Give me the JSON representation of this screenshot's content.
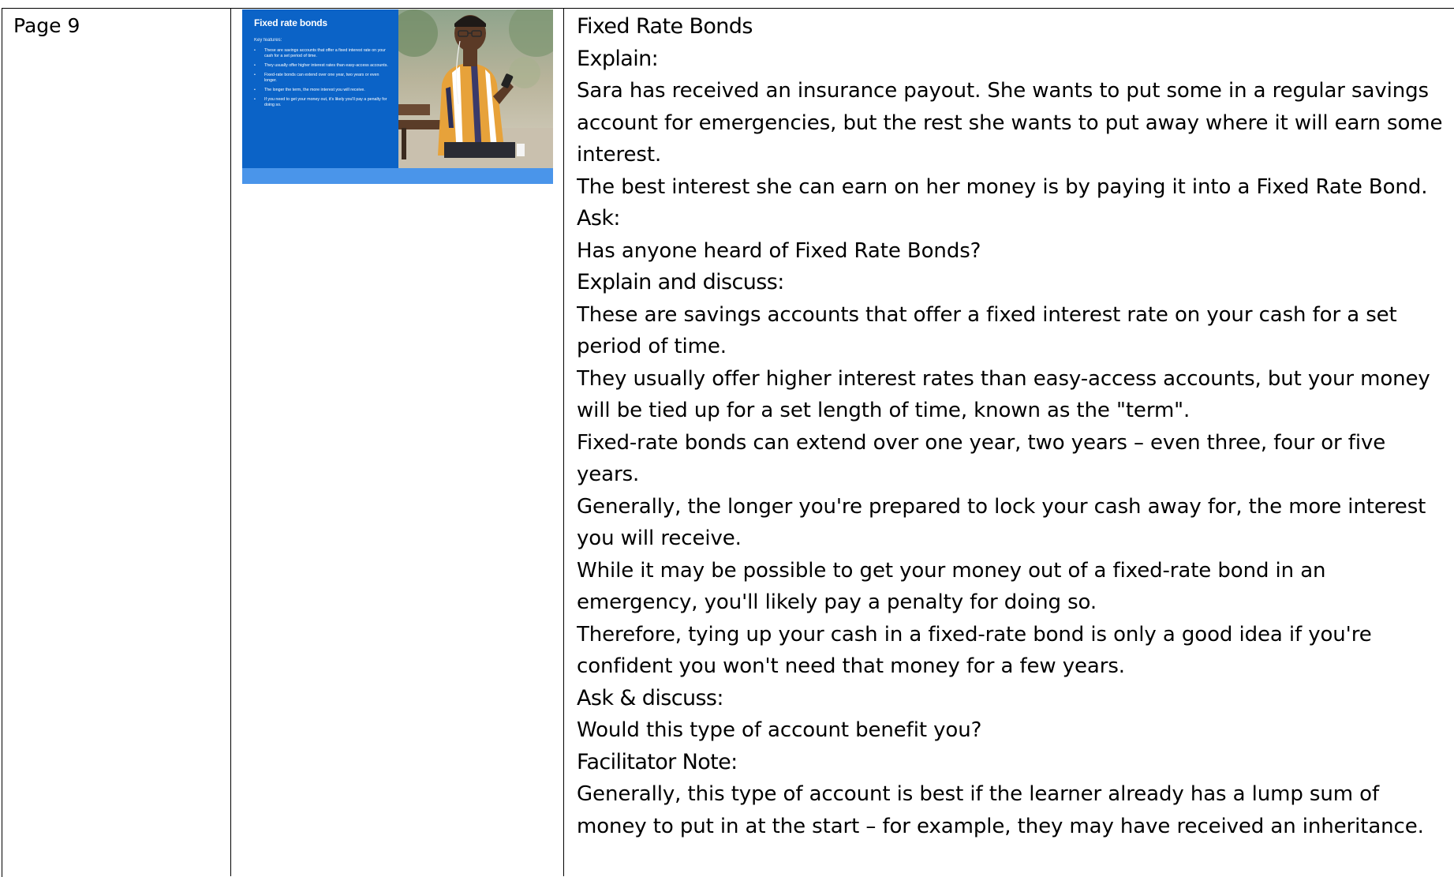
{
  "page": {
    "label": "Page 9"
  },
  "slide": {
    "title": "Fixed rate bonds",
    "key_label": "Key features:",
    "bullets": [
      "These are savings accounts that offer a fixed interest rate on your cash for a set period of time.",
      "They usually offer higher interest rates than easy-access accounts.",
      "Fixed-rate bonds can extend over one year, two years or even longer.",
      "The longer the term, the more interest you will receive.",
      "If you need to get your money out, it's likely you'll pay a penalty for doing so."
    ],
    "colors": {
      "background": "#0b63c7",
      "bar": "#4a95ea"
    }
  },
  "notes": {
    "title": "Fixed Rate Bonds",
    "explain_heading": "Explain:",
    "explain_lines": [
      "Sara has received an insurance payout. She wants to put some in a regular savings",
      "account for emergencies, but the rest she wants to put away where it will earn some",
      "interest.",
      "The best interest she can earn on her money is by paying it into a Fixed Rate Bond."
    ],
    "ask_heading": "Ask:",
    "ask_lines": [
      "Has anyone heard of Fixed Rate Bonds?"
    ],
    "discuss_heading": "Explain and discuss:",
    "discuss_lines": [
      "These are savings accounts that offer a fixed interest rate on your cash for a set",
      "period of time.",
      "They usually offer higher interest rates than easy-access accounts, but your money",
      "will be tied up for a set length of time, known as the \"term\".",
      "Fixed-rate bonds can extend over one year, two years – even three, four or five",
      "years.",
      "Generally, the longer you're prepared to lock your cash away for, the more interest",
      "you will receive.",
      "While it may be possible to get your money out of a fixed-rate bond in an",
      "emergency, you'll likely pay a penalty for doing so.",
      "Therefore, tying up your cash in a fixed-rate bond is only a good idea if you're",
      "confident you won't need that money for a few years."
    ],
    "ask_discuss_heading": "Ask & discuss:",
    "ask_discuss_lines": [
      "Would this type of account benefit you?"
    ],
    "facilitator_heading": "Facilitator Note:",
    "facilitator_lines": [
      "Generally, this type of account is best if the learner already has a lump sum of",
      "money to put in at the start – for example, they may have received an inheritance."
    ]
  }
}
